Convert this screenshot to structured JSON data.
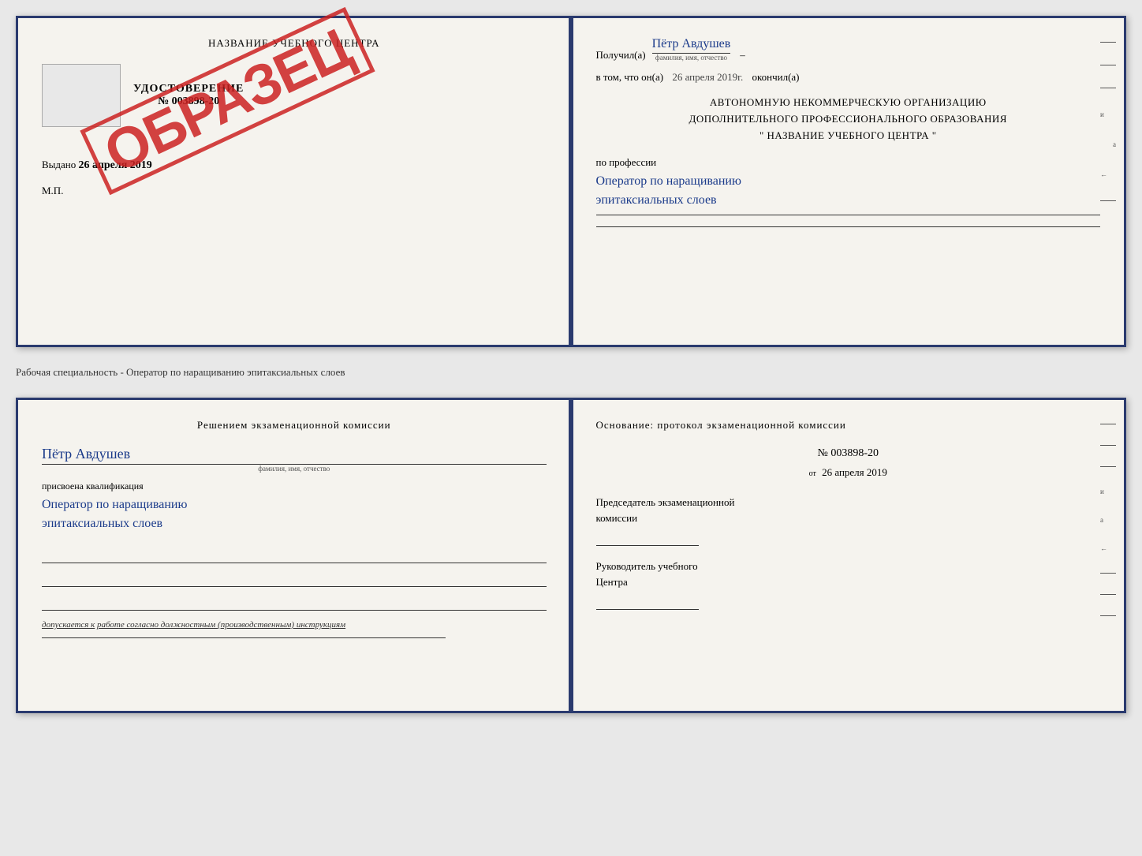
{
  "cert": {
    "left": {
      "title": "НАЗВАНИЕ УЧЕБНОГО ЦЕНТРА",
      "stamp_alt": "Место печати",
      "udost_label": "УДОСТОВЕРЕНИЕ",
      "udost_number": "№ 003898-20",
      "obrazec": "ОБРАЗЕЦ",
      "vydano_label": "Выдано",
      "vydano_date": "26 апреля 2019",
      "mp": "М.П."
    },
    "right": {
      "poluchil_label": "Получил(а)",
      "poluchil_name": "Пётр Авдушев",
      "fio_hint": "фамилия, имя, отчество",
      "vtom_label": "в том, что он(а)",
      "vtom_date": "26 апреля 2019г.",
      "okonchil_label": "окончил(а)",
      "org_line1": "АВТОНОМНУЮ НЕКОММЕРЧЕСКУЮ ОРГАНИЗАЦИЮ",
      "org_line2": "ДОПОЛНИТЕЛЬНОГО ПРОФЕССИОНАЛЬНОГО ОБРАЗОВАНИЯ",
      "org_line3": "\"  НАЗВАНИЕ УЧЕБНОГО ЦЕНТРА  \"",
      "professia_label": "по профессии",
      "professia_name": "Оператор по наращиванию",
      "professia_name2": "эпитаксиальных слоев"
    }
  },
  "middle_text": "Рабочая специальность - Оператор по наращиванию эпитаксиальных слоев",
  "proto": {
    "left": {
      "resheniy_title": "Решением  экзаменационной  комиссии",
      "name": "Пётр Авдушев",
      "fio_hint": "фамилия, имя, отчество",
      "prisvoena_label": "присвоена квалификация",
      "kvalif_line1": "Оператор по наращиванию",
      "kvalif_line2": "эпитаксиальных слоев",
      "dopuskaetsa_text": "допускается к",
      "dopuskaetsa_underline": "работе согласно должностным (производственным) инструкциям"
    },
    "right": {
      "osnovanie_title": "Основание: протокол экзаменационной  комиссии",
      "protocol_number": "№  003898-20",
      "ot_label": "от",
      "protocol_date": "26 апреля 2019",
      "chairman_label": "Председатель экзаменационной",
      "chairman_label2": "комиссии",
      "rukovoditel_label": "Руководитель учебного",
      "rukovoditel_label2": "Центра"
    }
  }
}
